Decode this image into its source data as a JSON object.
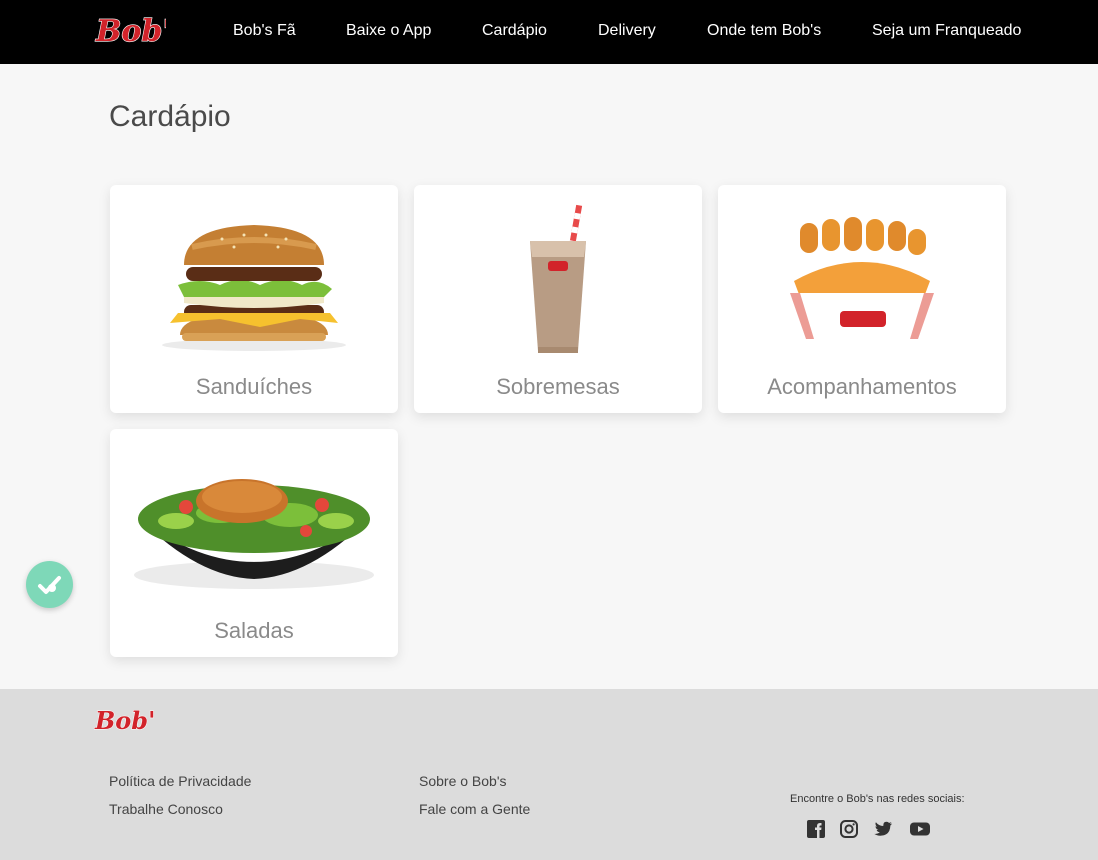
{
  "brand": {
    "logo_text": "Bob's",
    "color": "#d2232a"
  },
  "nav": {
    "items": [
      {
        "label": "Bob's Fã"
      },
      {
        "label": "Baixe o App"
      },
      {
        "label": "Cardápio"
      },
      {
        "label": "Delivery"
      },
      {
        "label": "Onde tem Bob's"
      },
      {
        "label": "Seja um Franqueado"
      }
    ]
  },
  "main": {
    "title": "Cardápio",
    "categories": [
      {
        "label": "Sanduíches",
        "icon": "burger-image"
      },
      {
        "label": "Sobremesas",
        "icon": "milkshake-image"
      },
      {
        "label": "Acompanhamentos",
        "icon": "fries-nuggets-image"
      },
      {
        "label": "Saladas",
        "icon": "salad-image"
      }
    ]
  },
  "accessibility": {
    "icon": "accessibility-icon",
    "color": "#7ed8b8"
  },
  "footer": {
    "links_left": [
      {
        "label": "Política de Privacidade"
      },
      {
        "label": "Trabalhe Conosco"
      }
    ],
    "links_middle": [
      {
        "label": "Sobre o Bob's"
      },
      {
        "label": "Fale com a Gente"
      }
    ],
    "social": {
      "text": "Encontre o Bob's nas redes sociais:",
      "icons": [
        "facebook-icon",
        "instagram-icon",
        "twitter-icon",
        "youtube-icon"
      ]
    }
  }
}
